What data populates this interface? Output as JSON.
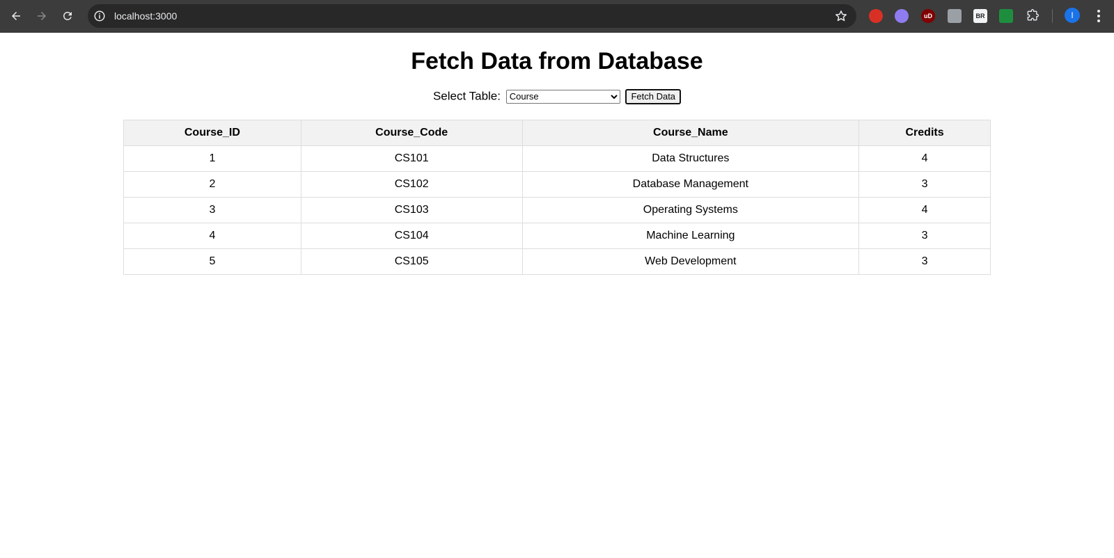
{
  "browser": {
    "url": "localhost:3000",
    "avatar_initial": "I",
    "extensions": [
      {
        "name": "extension-red-icon",
        "color": "#d93025",
        "label": ""
      },
      {
        "name": "extension-ghost-icon",
        "color": "#8e7cf0",
        "label": ""
      },
      {
        "name": "ublock-icon",
        "color": "#800000",
        "label": "uD"
      },
      {
        "name": "extension-play-icon",
        "color": "#9aa0a6",
        "label": ""
      },
      {
        "name": "extension-br-icon",
        "color": "#f1f3f4",
        "label": "BR"
      },
      {
        "name": "extension-cart-icon",
        "color": "#1e8e3e",
        "label": ""
      }
    ]
  },
  "page": {
    "title": "Fetch Data from Database",
    "select_label": "Select Table:",
    "select_value": "Course",
    "fetch_button": "Fetch Data"
  },
  "table": {
    "headers": [
      "Course_ID",
      "Course_Code",
      "Course_Name",
      "Credits"
    ],
    "rows": [
      [
        "1",
        "CS101",
        "Data Structures",
        "4"
      ],
      [
        "2",
        "CS102",
        "Database Management",
        "3"
      ],
      [
        "3",
        "CS103",
        "Operating Systems",
        "4"
      ],
      [
        "4",
        "CS104",
        "Machine Learning",
        "3"
      ],
      [
        "5",
        "CS105",
        "Web Development",
        "3"
      ]
    ]
  }
}
